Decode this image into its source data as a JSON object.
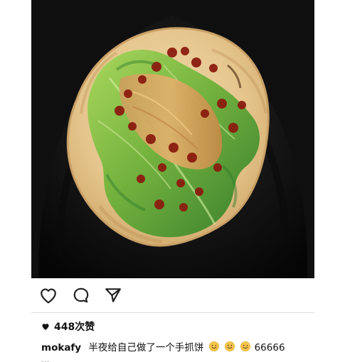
{
  "post": {
    "likes_count": "448次赞",
    "username": "mokafy",
    "caption_text": "半夜给自己做了一个手抓饼",
    "caption_tail": "66666",
    "cut_line": "..."
  },
  "icons": {
    "like": "heart-outline-icon",
    "comment": "comment-bubble-icon",
    "share": "send-icon",
    "likes": "heart-filled-icon",
    "emoji": "smiling-face-emoji"
  },
  "colors": {
    "pan": "#1b1b1b",
    "pancake": "#e9cc98",
    "lettuce": "#6fb23a",
    "sauce": "#8b1d10",
    "floss": "#d6a255",
    "divider": "#dedede",
    "text": "#111111"
  }
}
